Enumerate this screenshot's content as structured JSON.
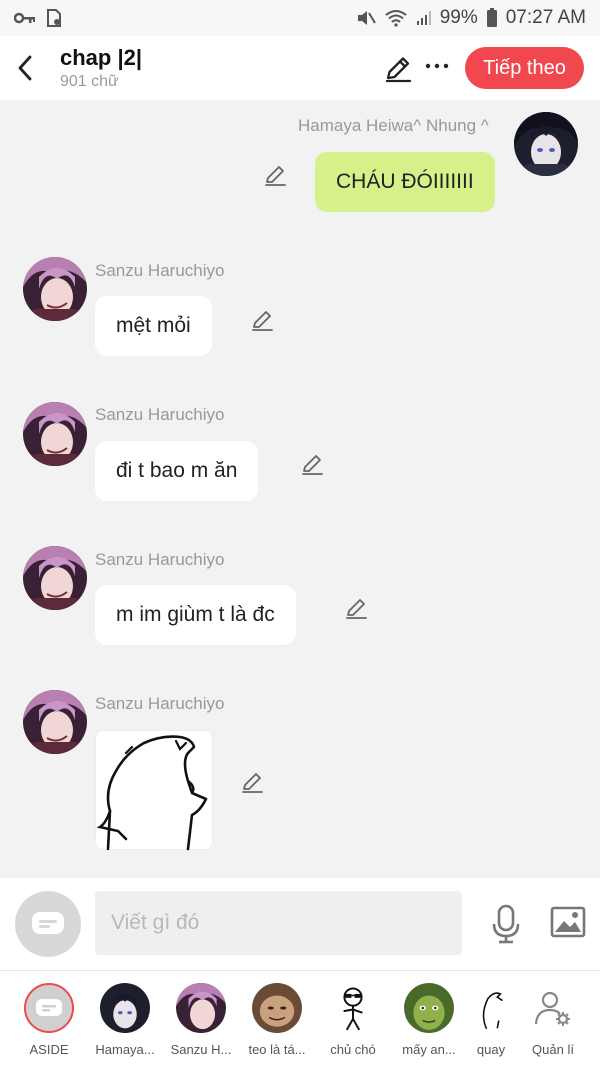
{
  "status_bar": {
    "battery": "99%",
    "time": "07:27 AM"
  },
  "header": {
    "title": "chap |2|",
    "subtitle": "901 chữ",
    "next_label": "Tiếp theo"
  },
  "messages": [
    {
      "sender": "Hamaya Heiwa^ Nhung ^",
      "text": "CHÁU ĐÓIIIIIII",
      "side": "right"
    },
    {
      "sender": "Sanzu Haruchiyo",
      "text": "mệt mỏi",
      "side": "left"
    },
    {
      "sender": "Sanzu Haruchiyo",
      "text": "đi t bao m ăn",
      "side": "left"
    },
    {
      "sender": "Sanzu Haruchiyo",
      "text": "m im giùm t là đc",
      "side": "left"
    },
    {
      "sender": "Sanzu Haruchiyo",
      "text": "",
      "side": "left",
      "image": "doodle-drawing"
    }
  ],
  "composer": {
    "placeholder": "Viết gì đó"
  },
  "characters": [
    {
      "label": "ASIDE"
    },
    {
      "label": "Hamaya..."
    },
    {
      "label": "Sanzu H..."
    },
    {
      "label": "teo là tá..."
    },
    {
      "label": "chủ chó"
    },
    {
      "label": "mấy an..."
    },
    {
      "label": "quay"
    },
    {
      "label": "Quản lí"
    }
  ],
  "colors": {
    "accent": "#f0484e",
    "my_bubble": "#d6f08a",
    "other_bubble": "#ffffff",
    "background": "#f2f2f2"
  }
}
